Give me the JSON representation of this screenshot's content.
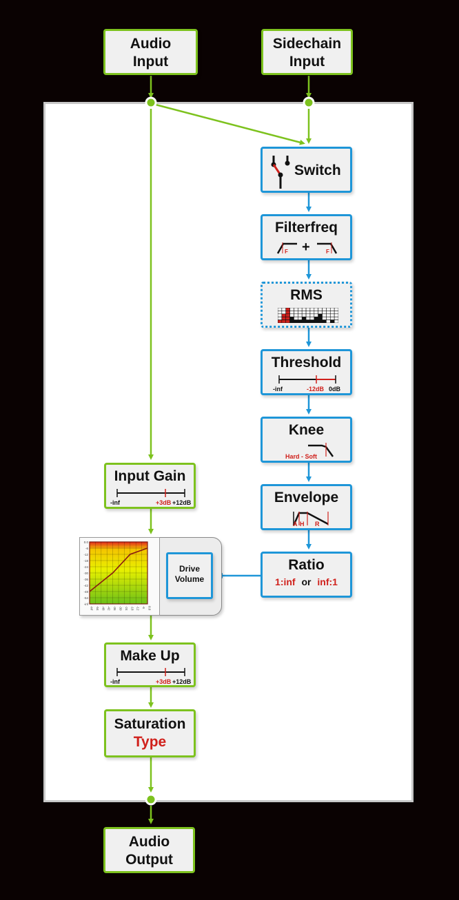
{
  "diagram": {
    "colors": {
      "background": "#0a0202",
      "panel": "#ffffff",
      "audio_path": "#7dc21e",
      "sidechain_path": "#1e96d8",
      "highlight": "#d0201b"
    },
    "external": {
      "audio_input": [
        "Audio",
        "Input"
      ],
      "sidechain_input": [
        "Sidechain",
        "Input"
      ],
      "audio_output": [
        "Audio",
        "Output"
      ]
    },
    "sidechain_chain": {
      "switch": {
        "title": "Switch",
        "icon": "switch-icon"
      },
      "filterfreq": {
        "title": "Filterfreq",
        "plus": "+",
        "hp_label": "F",
        "lp_label": "F",
        "icons": [
          "highpass-filter-icon",
          "lowpass-filter-icon"
        ]
      },
      "rms": {
        "title": "RMS",
        "icon": "rms-meter-icon"
      },
      "threshold": {
        "title": "Threshold",
        "min": "-inf",
        "value": "-12dB",
        "max": "0dB"
      },
      "knee": {
        "title": "Knee",
        "label": "Hard - Soft",
        "icon": "knee-curve-icon"
      },
      "envelope": {
        "title": "Envelope",
        "labels": [
          "A",
          "H",
          "R"
        ],
        "icon": "envelope-icon"
      },
      "ratio": {
        "title": "Ratio",
        "opt1": "1:inf",
        "or": "or",
        "opt2": "inf:1"
      }
    },
    "audio_chain": {
      "input_gain": {
        "title": "Input Gain",
        "min": "-inf",
        "value": "+3dB",
        "max": "+12dB"
      },
      "drive_volume": [
        "Drive",
        "Volume"
      ],
      "make_up": {
        "title": "Make Up",
        "min": "-inf",
        "value": "+3dB",
        "max": "+12dB"
      },
      "saturation": {
        "title": "Saturation",
        "type": "Type"
      }
    },
    "transfer_graph": {
      "y_ticks": [
        "0.0",
        "-6",
        "-12",
        "-18",
        "-24",
        "-30",
        "-36",
        "-42",
        "-48",
        "-54",
        "-inf"
      ],
      "x_ticks": [
        "-inf",
        "-54",
        "-48",
        "-42",
        "-36",
        "-30",
        "-24",
        "-18",
        "-12",
        "-6",
        "0.0"
      ],
      "curve": [
        [
          -60,
          -48
        ],
        [
          -36,
          -30
        ],
        [
          -18,
          -12
        ],
        [
          0,
          -6
        ]
      ]
    }
  }
}
